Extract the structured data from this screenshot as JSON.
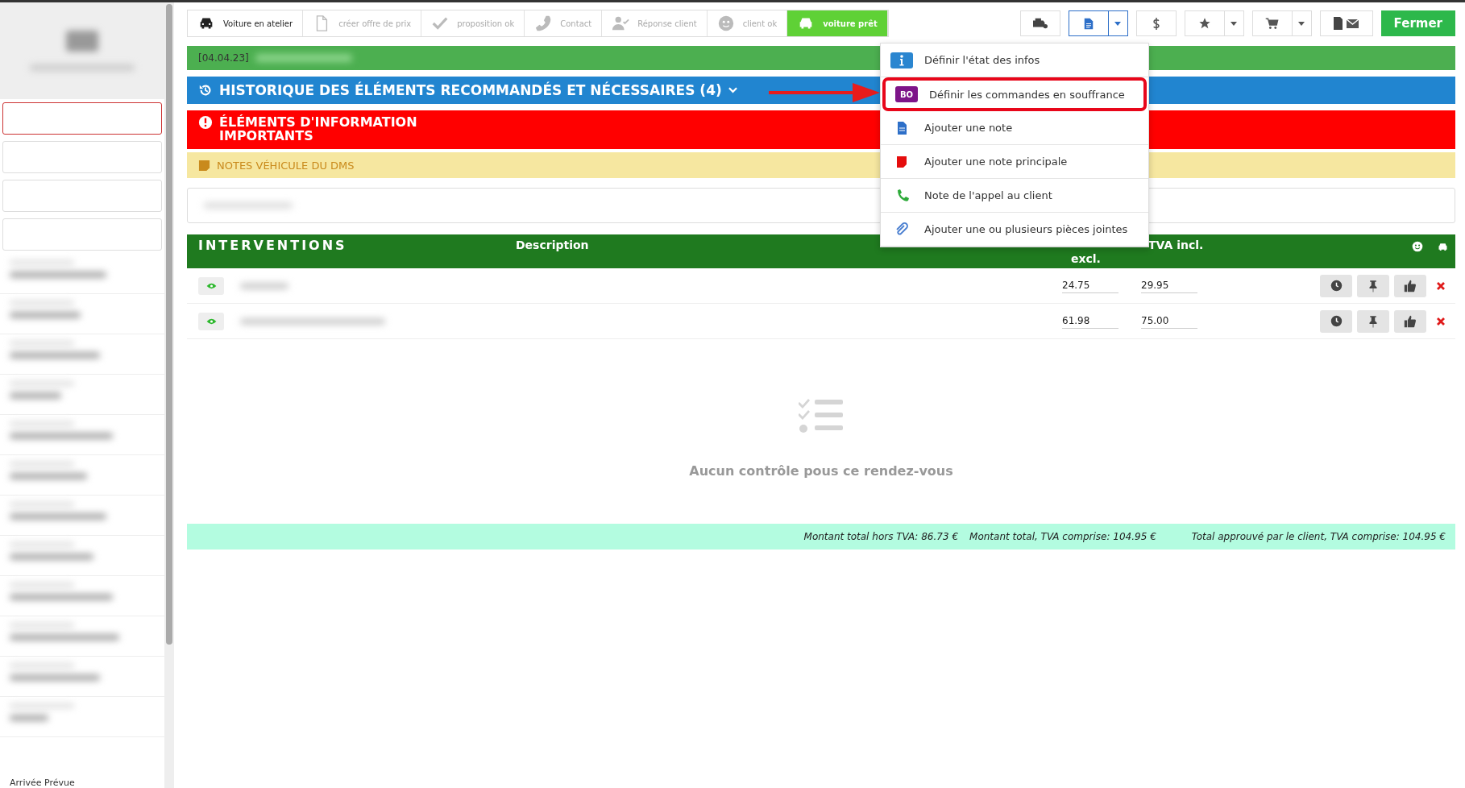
{
  "sidebar": {
    "footer_label": "Arrivée Prévue"
  },
  "steps": [
    {
      "label": "Voiture en atelier",
      "kind": "car",
      "done": true,
      "selected": false
    },
    {
      "label": "créer offre de prix",
      "kind": "file",
      "done": false,
      "selected": false
    },
    {
      "label": "proposition ok",
      "kind": "check",
      "done": false,
      "selected": false
    },
    {
      "label": "Contact",
      "kind": "phone",
      "done": false,
      "selected": false
    },
    {
      "label": "Réponse client",
      "kind": "user",
      "done": false,
      "selected": false
    },
    {
      "label": "client ok",
      "kind": "smile",
      "done": false,
      "selected": false
    },
    {
      "label": "voiture prêt",
      "kind": "car",
      "done": false,
      "selected": true
    }
  ],
  "toolbar": {
    "close_button": "Fermer",
    "notes_expanded": true
  },
  "menu": {
    "items": [
      {
        "label": "Définir l'état des infos",
        "kind": "info",
        "highlighted": false
      },
      {
        "label": "Définir les commandes en souffrance",
        "kind": "bo",
        "badge": "BO",
        "highlighted": true
      },
      {
        "label": "Ajouter une note",
        "kind": "note",
        "highlighted": false
      },
      {
        "label": "Ajouter une note principale",
        "kind": "main-note",
        "highlighted": false
      },
      {
        "label": "Note de l'appel au client",
        "kind": "call",
        "highlighted": false
      },
      {
        "label": "Ajouter une ou plusieurs pièces jointes",
        "kind": "attach",
        "highlighted": false
      }
    ]
  },
  "date_bar": "[04.04.23]",
  "history": "HISTORIQUE DES ÉLÉMENTS RECOMMANDÉS ET NÉCESSAIRES (4)",
  "important": "ÉLÉMENTS D'INFORMATION IMPORTANTS",
  "dms_notes": "NOTES VÉHICULE DU DMS",
  "table": {
    "columns": [
      "INTERVENTIONS",
      "Description",
      "excl.",
      "TVA incl."
    ],
    "rows": [
      {
        "price_excl": "24.75",
        "price_incl": "29.95"
      },
      {
        "price_excl": "61.98",
        "price_incl": "75.00"
      }
    ]
  },
  "empty_state": "Aucun contrôle pous ce rendez-vous",
  "totals": [
    "Montant total hors TVA: 86.73 €",
    "Montant total, TVA comprise: 104.95 €",
    "Total approuvé par le client, TVA comprise: 104.95 €"
  ]
}
